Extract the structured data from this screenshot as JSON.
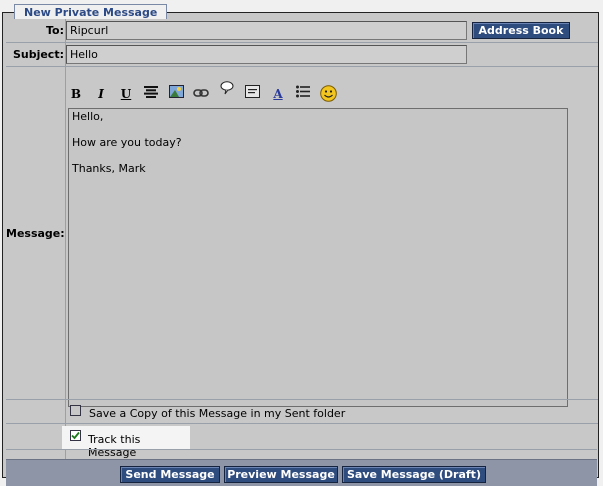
{
  "form": {
    "legend": "New Private Message",
    "to_label": "To:",
    "to_value": "Ripcurl",
    "address_book_label": "Address Book",
    "subject_label": "Subject:",
    "subject_value": "Hello",
    "message_label": "Message:",
    "message_lines": [
      "Hello,",
      "How are you today?",
      "Thanks, Mark"
    ]
  },
  "toolbar": {
    "icons": [
      "bold-icon",
      "italic-icon",
      "underline-icon",
      "align-center-icon",
      "image-icon",
      "link-icon",
      "speech-bubble-icon",
      "quote-icon",
      "font-color-icon",
      "list-icon",
      "smiley-icon"
    ],
    "bold_glyph": "B",
    "italic_glyph": "I",
    "underline_glyph": "U",
    "font_glyph": "A"
  },
  "options": {
    "save_copy_label": "Save a Copy of this Message in my Sent folder",
    "save_copy_checked": false,
    "track_label": "Track this Message",
    "track_checked": true
  },
  "buttons": {
    "send": "Send Message",
    "preview": "Preview Message",
    "save_draft": "Save Message (Draft)"
  },
  "colors": {
    "button_bg": "#2f4c7e",
    "legend_text": "#2c4a86",
    "footer_bg": "#8d95a6"
  }
}
